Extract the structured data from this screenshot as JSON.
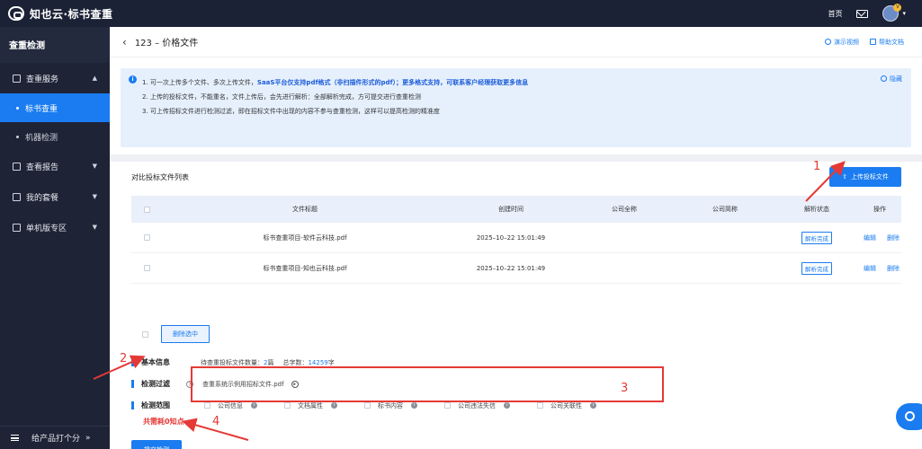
{
  "topbar": {
    "logo_text": "知也云·标书查重",
    "home_label": "首页",
    "avatar_badge": "V"
  },
  "sidebar": {
    "title": "查重检测",
    "groups": [
      {
        "label": "查重服务",
        "caret": "▲"
      },
      {
        "label": "查看报告",
        "caret": "▼"
      },
      {
        "label": "我的套餐",
        "caret": "▼"
      },
      {
        "label": "单机版专区",
        "caret": "▼"
      }
    ],
    "subitems": [
      {
        "label": "标书查重",
        "active": true
      },
      {
        "label": "机器检测",
        "active": false
      }
    ],
    "footer_label": "给产品打个分",
    "footer_icon": "»"
  },
  "header": {
    "back_icon": "‹",
    "title": "123 – 价格文件",
    "links": [
      "演示视频",
      "帮助文档"
    ]
  },
  "notice": {
    "info_icon": "i",
    "line1_prefix": "1. 可一次上传多个文件、多次上传文件，",
    "line1_bold": "SaaS平台仅支持pdf格式（非扫描件形式的pdf）；更多格式支持，可联系客户经理获取更多信息",
    "line2": "2. 上传的投标文件，不能重名，文件上传后，会先进行解析：全部解析完成，方可提交进行查重检测",
    "line3": "3. 可上传招标文件进行检测过滤，即在招标文件中出现的内容不参与查重检测，这样可以提高检测的精准度",
    "hide_label": "隐藏"
  },
  "file_list": {
    "title": "对比投标文件列表",
    "upload_label": "上传投标文件",
    "upload_icon": "⇧",
    "columns": [
      "文件标题",
      "创建时间",
      "公司全称",
      "公司简称",
      "解析状态",
      "操作"
    ],
    "rows": [
      {
        "title": "标书查重项目-软件云科技.pdf",
        "created": "2025–10–22 15:01:49",
        "full_name": "",
        "short_name": "",
        "status": "解析完成",
        "edit": "编辑",
        "delete": "删除"
      },
      {
        "title": "标书查重项目-知也云科技.pdf",
        "created": "2025–10–22 15:01:49",
        "full_name": "",
        "short_name": "",
        "status": "解析完成",
        "edit": "编辑",
        "delete": "删除"
      }
    ],
    "delete_selected_label": "删除选中"
  },
  "basic_info": {
    "label": "基本信息",
    "count_prefix": "待查重投标文件数量：",
    "count_value": "2",
    "count_unit": "篇",
    "chars_prefix": "总字数：",
    "chars_value": "14259",
    "chars_unit": "字"
  },
  "filter": {
    "label": "检测过滤",
    "file": "查重系统示例用招标文件.pdf"
  },
  "scope": {
    "label": "检测范围",
    "options": [
      "公司信息",
      "文档属性",
      "标书内容",
      "公司违法失信",
      "公司关联性"
    ]
  },
  "cost_text": "共需耗0知点",
  "submit_label": "提交检测",
  "annotations": [
    "1",
    "2",
    "3",
    "4"
  ],
  "colors": {
    "accent": "#1a7cf0",
    "sidebar_bg": "#1e2436",
    "topbar_bg": "#1b2236",
    "annotation_red": "#e53935"
  }
}
